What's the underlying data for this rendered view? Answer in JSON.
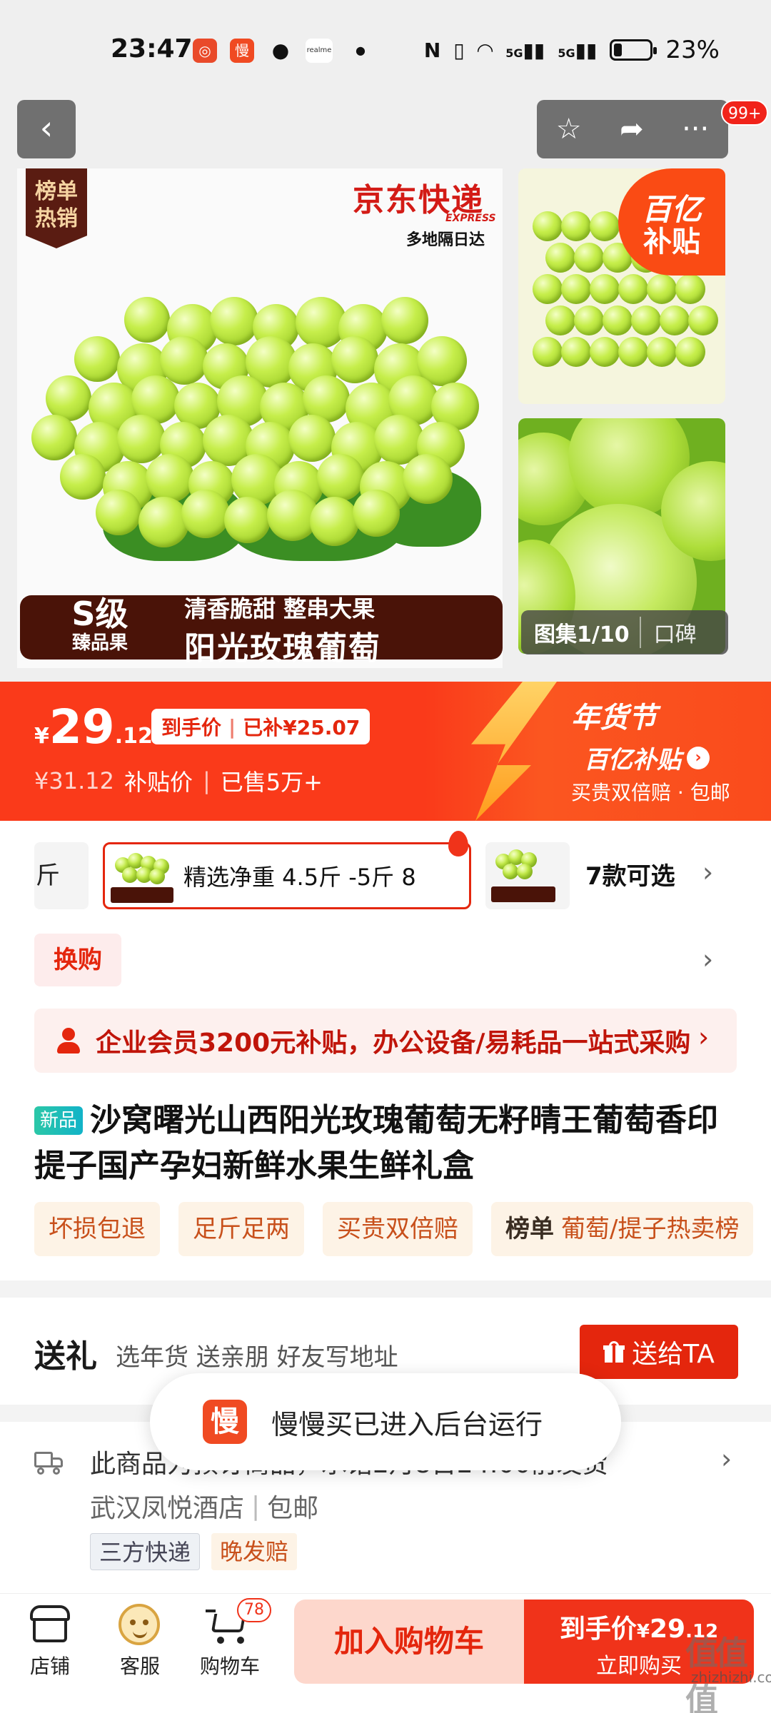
{
  "status_bar": {
    "time": "23:47",
    "battery_text": "23%",
    "battery_level": 0.23,
    "network_1": "5G",
    "network_2": "5G",
    "app_label": "realme",
    "icons": [
      "app-notification-icon",
      "slow-buy-app-icon",
      "wechat-icon",
      "realme-icon",
      "dot-icon",
      "nfc-icon",
      "vibrate-icon",
      "wifi-icon",
      "signal-icon",
      "battery-icon"
    ]
  },
  "header": {
    "back_icon": "chevron-left-icon",
    "favorite_icon": "star-icon",
    "share_icon": "share-icon",
    "more_icon": "more-icon",
    "message_badge": "99+"
  },
  "gallery": {
    "rank_tag": "榜单热销",
    "brand_name": "京东快递",
    "brand_express": "EXPRESS",
    "brand_sub": "多地隔日达",
    "s_level_main": "S级",
    "s_level_sub": "臻品果",
    "banner_tagline": "清香脆甜  整串大果",
    "banner_name": "阳光玫瑰葡萄",
    "subsidy_logo_line1": "百亿",
    "subsidy_logo_line2": "补贴",
    "counter": "图集1/10",
    "reviews_tab": "口碑"
  },
  "price": {
    "currency": "¥",
    "integer": "29",
    "decimal": ".12",
    "final_price_label": "到手价",
    "subsidized": "已补¥25.07",
    "original_price": "¥31.12",
    "subsidy_price_label": "补贴价",
    "sold": "已售5万+",
    "festival": "年货节",
    "subsidy_promo": "百亿补贴",
    "promo_sub": "买贵双倍赔 · 包邮"
  },
  "sku": {
    "partial_left": "斤",
    "selected_label": "精选净重 4.5斤 -5斤 8",
    "count_label": "7款可选"
  },
  "exchange": {
    "label": "换购"
  },
  "enterprise": {
    "text": "企业会员3200元补贴，办公设备/易耗品一站式采购"
  },
  "product": {
    "new_tag": "新品",
    "title": "沙窝曙光山西阳光玫瑰葡萄无籽晴王葡萄香印提子国产孕妇新鲜水果生鲜礼盒"
  },
  "service_tags": [
    {
      "label": "坏损包退"
    },
    {
      "label": "足斤足两"
    },
    {
      "label": "买贵双倍赔"
    },
    {
      "strong": "榜单",
      "label": "葡萄/提子热卖榜"
    }
  ],
  "gift": {
    "title": "送礼",
    "sub": "选年货 送亲朋 好友写地址",
    "button": "送给TA"
  },
  "shipping": {
    "line1": "此商品为预订商品，承诺2月8日24:00前发货",
    "store": "武汉凤悦酒店",
    "free_shipping": "包邮",
    "tag_express": "三方快递",
    "tag_late": "晚发赔"
  },
  "toast": {
    "icon_text": "慢",
    "text": "慢慢买已进入后台运行"
  },
  "bottom_bar": {
    "store": "店铺",
    "service": "客服",
    "cart": "购物车",
    "cart_count": "78",
    "add_to_cart": "加入购物车",
    "buy_price_label": "到手价",
    "buy_currency": "¥",
    "buy_price_int": "29",
    "buy_price_dec": ".12",
    "buy_now": "立即购买"
  },
  "watermark": {
    "mark": "值值值",
    "text": "zhizhizhi.com"
  },
  "colors": {
    "accent_red": "#e4260d",
    "price_orange": "#fa3a1a",
    "grape_green": "#c6ee4b"
  }
}
